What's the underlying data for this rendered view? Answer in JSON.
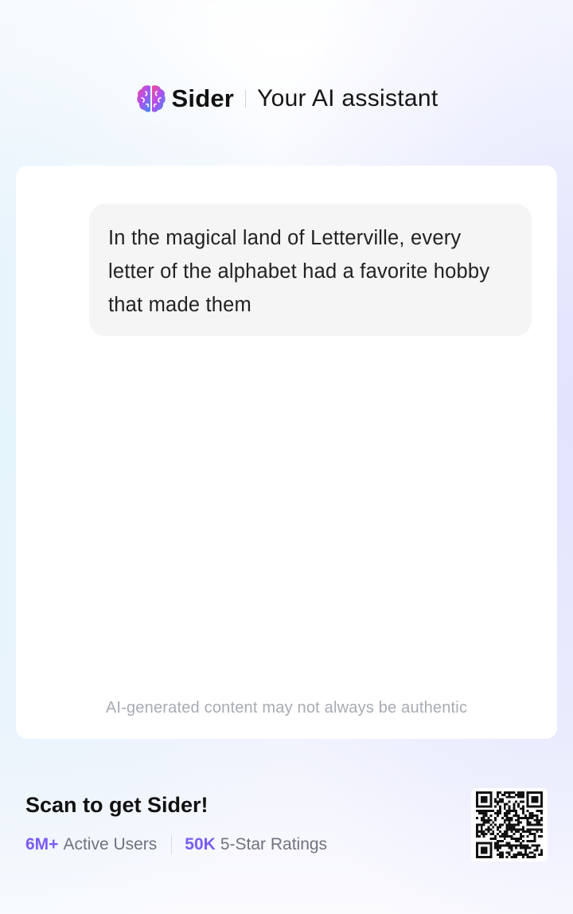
{
  "header": {
    "logo_icon": "brain-icon",
    "brand_name": "Sider",
    "tagline": "Your AI assistant"
  },
  "chat": {
    "message": "In the magical land of Letterville, every letter of the alphabet had a favorite hobby that made them",
    "disclaimer": "AI-generated content may not always be authentic"
  },
  "footer": {
    "cta": "Scan to get Sider!",
    "stats": [
      {
        "value": "6M+",
        "label": "Active Users"
      },
      {
        "value": "50K",
        "label": "5-Star Ratings"
      }
    ],
    "qr_icon": "qr-code-icon"
  },
  "colors": {
    "accent": "#7b5cf5",
    "bubble_bg": "#f5f5f6",
    "muted_text": "#a8abb3"
  }
}
